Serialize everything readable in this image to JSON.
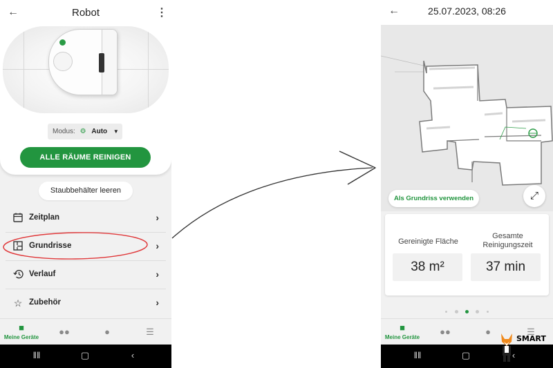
{
  "left_screen": {
    "header": {
      "title": "Robot",
      "back_icon": "arrow-left-icon",
      "menu_icon": "more-vert-icon"
    },
    "mode": {
      "label": "Modus:",
      "value": "Auto",
      "icon": "auto-mode-icon"
    },
    "primary_action": "ALLE RÄUME REINIGEN",
    "secondary_action": "Staubbehälter leeren",
    "menu": [
      {
        "label": "Zeitplan",
        "icon": "calendar-icon"
      },
      {
        "label": "Grundrisse",
        "icon": "floorplan-icon",
        "highlighted": true
      },
      {
        "label": "Verlauf",
        "icon": "history-icon"
      },
      {
        "label": "Zubehör",
        "icon": "star-icon"
      }
    ],
    "bottom_nav": [
      {
        "label": "Meine Geräte",
        "icon": "home-icon",
        "active": true
      },
      {
        "label": "",
        "icon": "people-icon",
        "active": false
      },
      {
        "label": "",
        "icon": "person-icon",
        "active": false
      },
      {
        "label": "",
        "icon": "menu-icon",
        "active": false
      }
    ]
  },
  "right_screen": {
    "header": {
      "title": "25.07.2023, 08:26",
      "back_icon": "arrow-left-icon"
    },
    "map": {
      "use_button": "Als Grundriss verwenden",
      "expand_icon": "expand-icon"
    },
    "stats": [
      {
        "label": "Gereinigte Fläche",
        "value": "38 m²"
      },
      {
        "label": "Gesamte Reinigungszeit",
        "value": "37 min"
      }
    ],
    "pager": {
      "count": 5,
      "active_index": 2
    },
    "bottom_nav": [
      {
        "label": "Meine Geräte",
        "icon": "home-icon",
        "active": true
      },
      {
        "label": "",
        "icon": "people-icon",
        "active": false
      },
      {
        "label": "",
        "icon": "person-icon",
        "active": false
      },
      {
        "label": "",
        "icon": "menu-icon",
        "active": false
      }
    ]
  },
  "system_bar": {
    "icons": [
      "recent-apps-icon",
      "home-button-icon",
      "back-button-icon"
    ]
  },
  "logo": {
    "text": "SMART"
  },
  "colors": {
    "accent": "#22953f",
    "highlight": "#e0383a",
    "background": "#f1f1f1",
    "map_background": "#e8e8e8"
  }
}
